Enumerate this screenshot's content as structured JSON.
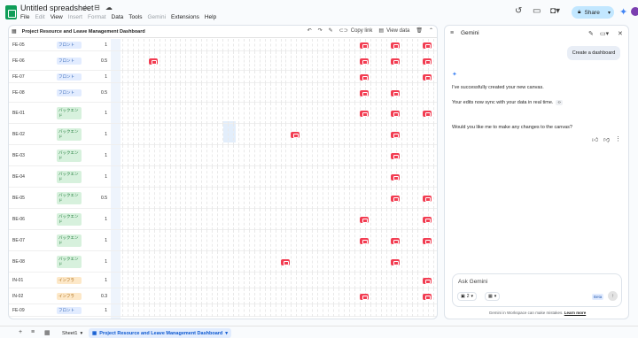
{
  "app": {
    "title": "Untitled spreadsheet",
    "menu": [
      "File",
      "Edit",
      "View",
      "Insert",
      "Format",
      "Data",
      "Tools",
      "Gemini",
      "Extensions",
      "Help"
    ],
    "menu_disabled": [
      false,
      true,
      false,
      true,
      true,
      false,
      false,
      true,
      false,
      false
    ],
    "share_label": "Share"
  },
  "sheet": {
    "title": "Project Resource and Leave Management Dashboard",
    "copy_link": "Copy link",
    "view_data": "View data",
    "rows": [
      {
        "id": "FE-05",
        "team": "フロント",
        "kind": "front",
        "value": "1",
        "marks": [
          45,
          51,
          57
        ]
      },
      {
        "id": "FE-06",
        "team": "フロント",
        "kind": "front",
        "value": "0.5",
        "marks": [
          5,
          45,
          51,
          57
        ]
      },
      {
        "id": "FE-07",
        "team": "フロント",
        "kind": "front",
        "value": "1",
        "marks": [
          45,
          57
        ]
      },
      {
        "id": "FE-08",
        "team": "フロント",
        "kind": "front",
        "value": "0.5",
        "marks": [
          45,
          51
        ]
      },
      {
        "id": "BE-01",
        "team": "バックエンド",
        "kind": "back",
        "value": "1",
        "marks": [
          45,
          51,
          57
        ]
      },
      {
        "id": "BE-02",
        "team": "バックエンド",
        "kind": "back",
        "value": "1",
        "marks": [
          32,
          51
        ]
      },
      {
        "id": "BE-03",
        "team": "バックエンド",
        "kind": "back",
        "value": "1",
        "marks": [
          51
        ]
      },
      {
        "id": "BE-04",
        "team": "バックエンド",
        "kind": "back",
        "value": "1",
        "marks": [
          51
        ]
      },
      {
        "id": "BE-05",
        "team": "バックエンド",
        "kind": "back",
        "value": "0.5",
        "marks": [
          51,
          57
        ]
      },
      {
        "id": "BE-06",
        "team": "バックエンド",
        "kind": "back",
        "value": "1",
        "marks": [
          45,
          57
        ]
      },
      {
        "id": "BE-07",
        "team": "バックエンド",
        "kind": "back",
        "value": "1",
        "marks": [
          45,
          51,
          57
        ]
      },
      {
        "id": "BE-08",
        "team": "バックエンド",
        "kind": "back",
        "value": "1",
        "marks": [
          30,
          51
        ]
      },
      {
        "id": "IN-01",
        "team": "インフラ",
        "kind": "infra",
        "value": "1",
        "marks": [
          57
        ]
      },
      {
        "id": "IN-02",
        "team": "インフラ",
        "kind": "infra",
        "value": "0.3",
        "marks": [
          45,
          57
        ]
      },
      {
        "id": "FE-09",
        "team": "フロント",
        "kind": "front",
        "value": "1",
        "marks": []
      }
    ]
  },
  "gemini": {
    "title": "Gemini",
    "user_message": "Create a dashboard",
    "reply_1": "I've successfully created your new canvas.",
    "reply_2": "Your edits now sync with your data in real time.",
    "reply_3": "Would you like me to make any changes to the canvas?",
    "ask_placeholder": "Ask Gemini",
    "chip_count": "2",
    "beta": "Beta",
    "disclaimer": "Gemini in Workspace can make mistakes.",
    "learn_more": "Learn more"
  },
  "tabs": {
    "sheet1": "Sheet1",
    "dashboard": "Project Resource and Leave Management Dashboard"
  }
}
